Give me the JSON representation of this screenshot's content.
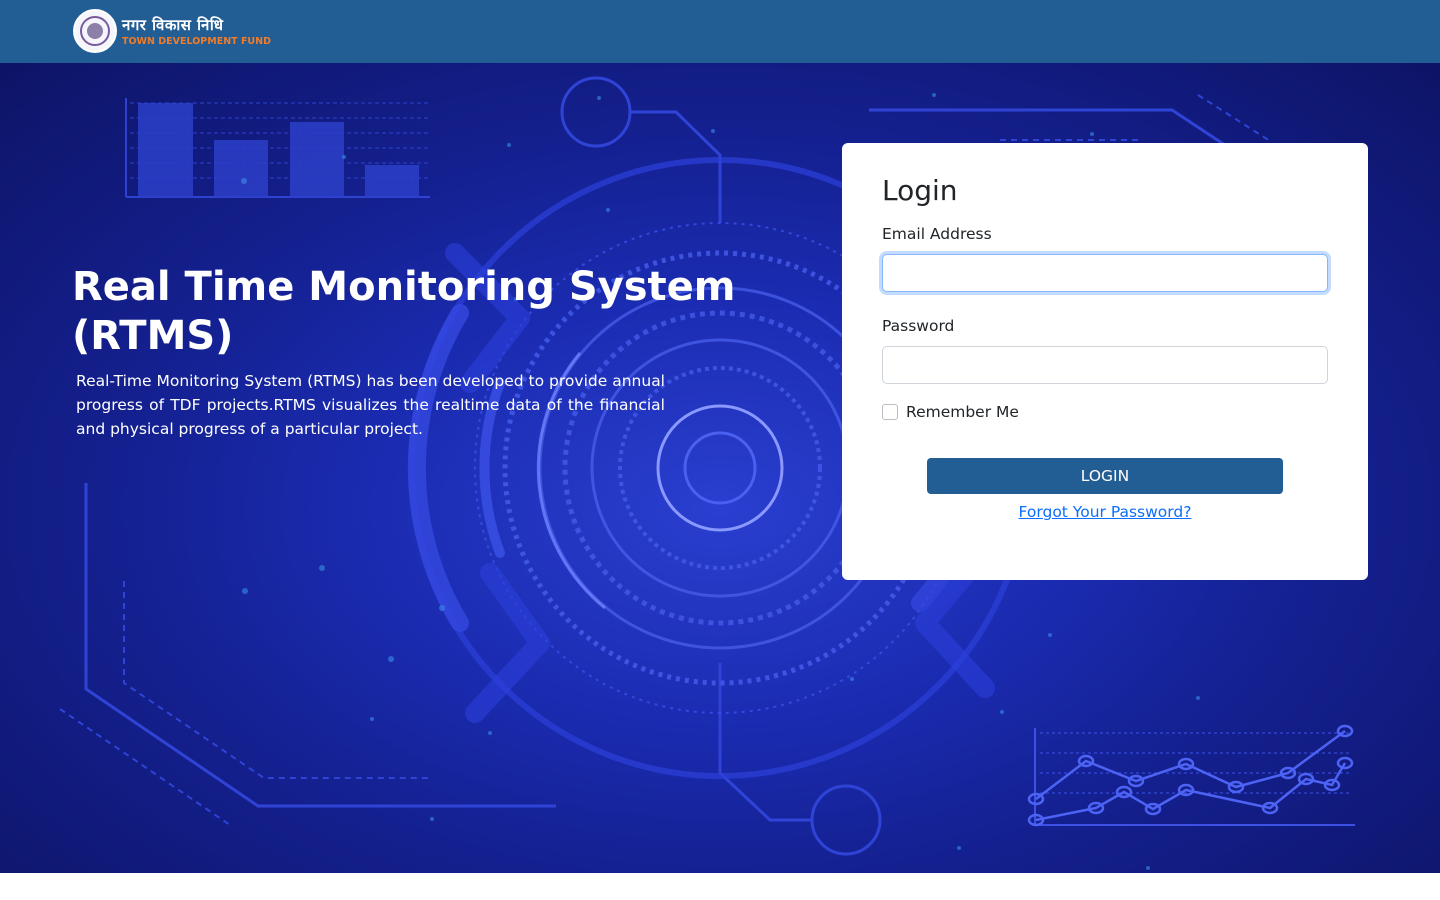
{
  "header": {
    "org_name_hindi": "नगर विकास निधि",
    "org_name_english": "TOWN DEVELOPMENT FUND",
    "logo_icon": "emblem-seal-icon"
  },
  "hero": {
    "title": "Real Time Monitoring System (RTMS)",
    "description": "Real-Time Monitoring System (RTMS) has been developed to provide annual progress of TDF projects.RTMS visualizes the realtime data of the financial and physical progress of a particular project."
  },
  "login": {
    "title": "Login",
    "email_label": "Email Address",
    "email_value": "",
    "password_label": "Password",
    "password_value": "",
    "remember_label": "Remember Me",
    "remember_checked": false,
    "submit_label": "LOGIN",
    "forgot_label": "Forgot Your Password?"
  },
  "colors": {
    "header_bg": "#225e94",
    "brand_orange": "#f07c2a",
    "button_bg": "#225e94",
    "link": "#0d6efd",
    "hero_bg": "#1a2bb0"
  }
}
